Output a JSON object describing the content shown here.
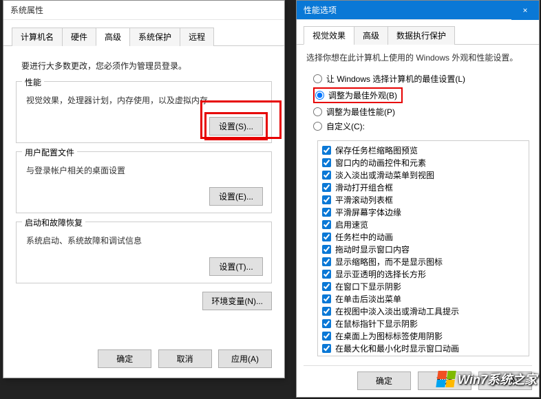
{
  "sysprops": {
    "title": "系统属性",
    "tabs": [
      "计算机名",
      "硬件",
      "高级",
      "系统保护",
      "远程"
    ],
    "active_tab": 2,
    "admin_msg": "要进行大多数更改，您必须作为管理员登录。",
    "groups": {
      "performance": {
        "title": "性能",
        "desc": "视觉效果，处理器计划，内存使用，以及虚拟内存",
        "btn": "设置(S)..."
      },
      "profiles": {
        "title": "用户配置文件",
        "desc": "与登录帐户相关的桌面设置",
        "btn": "设置(E)..."
      },
      "startup": {
        "title": "启动和故障恢复",
        "desc": "系统启动、系统故障和调试信息",
        "btn": "设置(T)..."
      }
    },
    "env_btn": "环境变量(N)...",
    "ok": "确定",
    "cancel": "取消",
    "apply": "应用(A)"
  },
  "perfopt": {
    "title": "性能选项",
    "close_icon": "×",
    "tabs": [
      "视觉效果",
      "高级",
      "数据执行保护"
    ],
    "active_tab": 0,
    "desc": "选择你想在此计算机上使用的 Windows 外观和性能设置。",
    "radios": [
      {
        "label": "让 Windows 选择计算机的最佳设置(L)",
        "checked": false
      },
      {
        "label": "调整为最佳外观(B)",
        "checked": true
      },
      {
        "label": "调整为最佳性能(P)",
        "checked": false
      },
      {
        "label": "自定义(C):",
        "checked": false
      }
    ],
    "checks": [
      "保存任务栏缩略图预览",
      "窗口内的动画控件和元素",
      "淡入淡出或滑动菜单到视图",
      "滑动打开组合框",
      "平滑滚动列表框",
      "平滑屏幕字体边缘",
      "启用速览",
      "任务栏中的动画",
      "拖动时显示窗口内容",
      "显示缩略图，而不是显示图标",
      "显示亚透明的选择长方形",
      "在窗口下显示阴影",
      "在单击后淡出菜单",
      "在视图中淡入淡出或滑动工具提示",
      "在鼠标指针下显示阴影",
      "在桌面上为图标标签使用阴影",
      "在最大化和最小化时显示窗口动画"
    ],
    "ok": "确定",
    "cancel": "取消",
    "apply": "应用(A)"
  },
  "watermark": "Win7系统之家"
}
